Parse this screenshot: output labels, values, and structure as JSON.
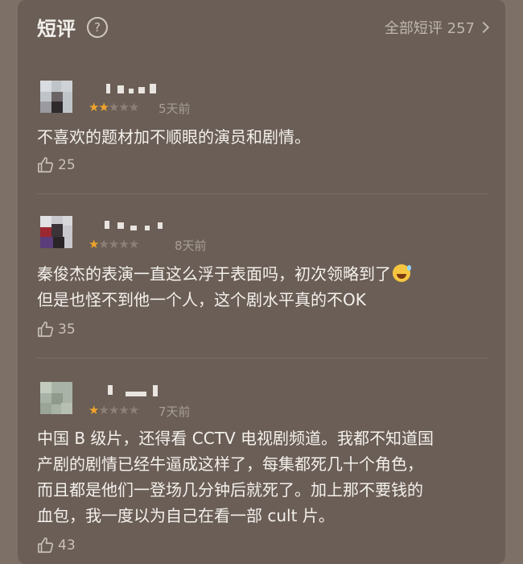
{
  "header": {
    "title": "短评",
    "help_icon": "question-circle-icon",
    "all_link": "全部短评 257"
  },
  "reviews": [
    {
      "rating": 2,
      "time": "5天前",
      "lines": [
        "不喜欢的题材加不顺眼的演员和剧情。"
      ],
      "likes": "25"
    },
    {
      "rating": 1,
      "time": "8天前",
      "lines": [
        "秦俊杰的表演一直这么浮于表面吗，初次领略到了",
        "但是也怪不到他一个人，这个剧水平真的不OK"
      ],
      "emoji": "grinning-sweat-emoji",
      "likes": "35"
    },
    {
      "rating": 1,
      "time": "7天前",
      "lines": [
        "中国 B 级片，还得看 CCTV 电视剧频道。我都不知道国",
        "产剧的剧情已经牛逼成这样了，每集都死几十个角色，",
        "而且都是他们一登场几分钟后就死了。加上那不要钱的",
        "血包，我一度以为自己在看一部 cult 片。"
      ],
      "likes": "43"
    }
  ],
  "colors": {
    "star_on": "#f0a32b",
    "star_off": "#8d8077",
    "panel_bg": "#6a5e56"
  }
}
